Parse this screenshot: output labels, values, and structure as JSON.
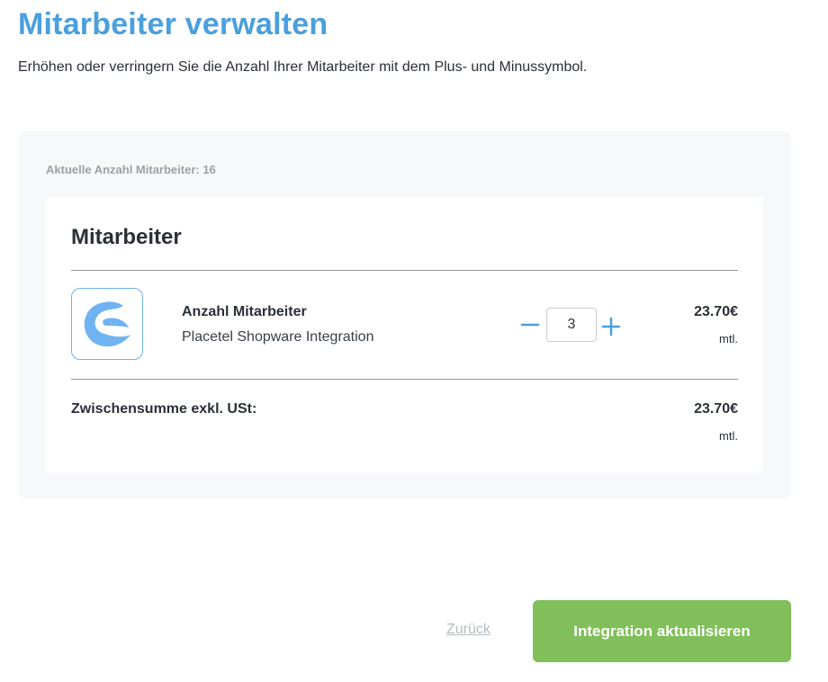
{
  "header": {
    "title": "Mitarbeiter verwalten",
    "subtitle": "Erhöhen oder verringern Sie die Anzahl Ihrer Mitarbeiter mit dem Plus- und Minussymbol."
  },
  "panel": {
    "current_count_label": "Aktuelle Anzahl Mitarbeiter: 16"
  },
  "card": {
    "title": "Mitarbeiter",
    "product": {
      "name": "Anzahl Mitarbeiter",
      "description": "Placetel Shopware Integration",
      "logo_icon": "shopware-logo-icon",
      "quantity": "3",
      "price": "23.70€",
      "price_unit": "mtl."
    },
    "subtotal": {
      "label": "Zwischensumme exkl. USt:",
      "price": "23.70€",
      "price_unit": "mtl."
    }
  },
  "footer": {
    "back_label": "Zurück",
    "submit_label": "Integration aktualisieren"
  },
  "colors": {
    "title": "#4a9fdd",
    "accent_blue": "#4a9fdd",
    "logo_blue": "#6fb3f2",
    "button_green": "#80bf59",
    "panel_bg": "#f7f8fa",
    "muted_text": "#9ba1a8"
  }
}
